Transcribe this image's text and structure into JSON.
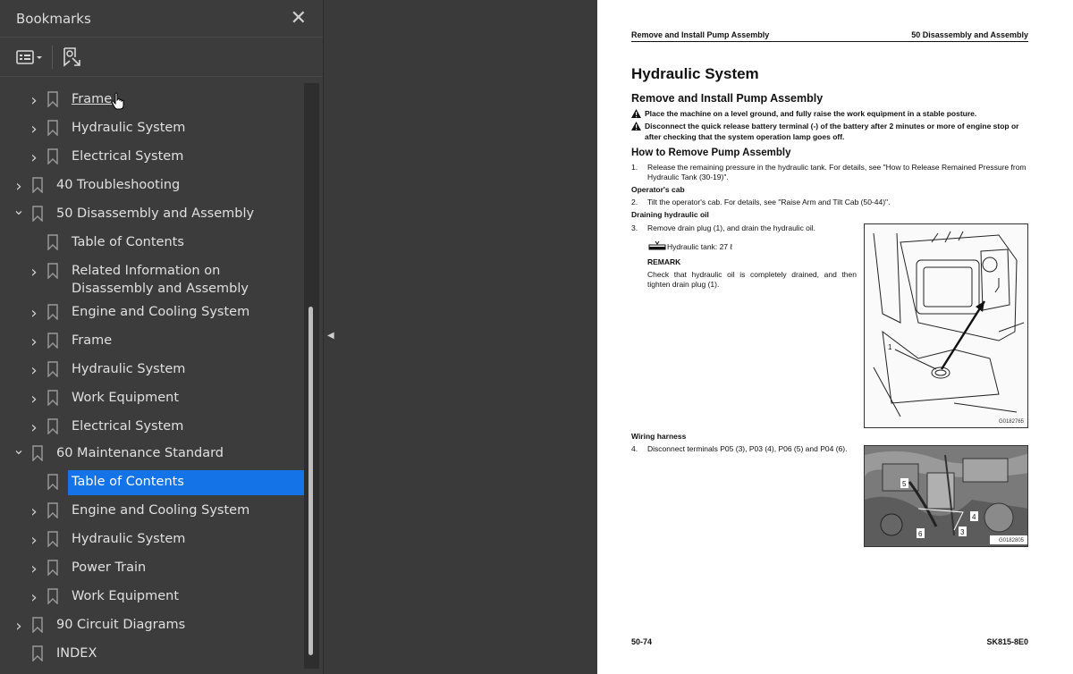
{
  "panel": {
    "title": "Bookmarks",
    "items": [
      {
        "label": "Frame",
        "level": 2,
        "expand": "collapsed",
        "state": "hover"
      },
      {
        "label": "Hydraulic System",
        "level": 2,
        "expand": "collapsed"
      },
      {
        "label": "Electrical System",
        "level": 2,
        "expand": "collapsed"
      },
      {
        "label": "40 Troubleshooting",
        "level": 1,
        "expand": "collapsed"
      },
      {
        "label": "50 Disassembly and Assembly",
        "level": 1,
        "expand": "expanded"
      },
      {
        "label": "Table of Contents",
        "level": 2,
        "expand": "none"
      },
      {
        "label": "Related Information on Disassembly and Assembly",
        "level": 2,
        "expand": "collapsed"
      },
      {
        "label": "Engine and Cooling System",
        "level": 2,
        "expand": "collapsed"
      },
      {
        "label": "Frame",
        "level": 2,
        "expand": "collapsed"
      },
      {
        "label": "Hydraulic System",
        "level": 2,
        "expand": "collapsed"
      },
      {
        "label": "Work Equipment",
        "level": 2,
        "expand": "collapsed"
      },
      {
        "label": "Electrical System",
        "level": 2,
        "expand": "collapsed"
      },
      {
        "label": "60 Maintenance Standard",
        "level": 1,
        "expand": "expanded"
      },
      {
        "label": "Table of Contents",
        "level": 2,
        "expand": "none",
        "state": "selected"
      },
      {
        "label": "Engine and Cooling System",
        "level": 2,
        "expand": "collapsed"
      },
      {
        "label": "Hydraulic System",
        "level": 2,
        "expand": "collapsed"
      },
      {
        "label": "Power Train",
        "level": 2,
        "expand": "collapsed"
      },
      {
        "label": "Work Equipment",
        "level": 2,
        "expand": "collapsed"
      },
      {
        "label": "90 Circuit Diagrams",
        "level": 1,
        "expand": "collapsed"
      },
      {
        "label": "INDEX",
        "level": 1,
        "expand": "none"
      }
    ]
  },
  "colors": {
    "selection": "#1473e6",
    "panel_bg": "#3c3c3c",
    "gutter_bg": "#3a3a3a"
  },
  "doc": {
    "header_left": "Remove and Install Pump Assembly",
    "header_right": "50 Disassembly and Assembly",
    "title": "Hydraulic System",
    "subtitle": "Remove and Install Pump Assembly",
    "warning1": "Place the machine on a level ground, and fully raise the work equipment in a stable posture.",
    "warning2": "Disconnect the quick release battery terminal (-) of the battery after 2 minutes or more of engine stop or after checking that the system operation lamp goes off.",
    "section": "How to Remove Pump Assembly",
    "step1_num": "1.",
    "step1": "Release the remaining pressure in the hydraulic tank. For details, see \"How to Release Remained Pressure from Hydraulic Tank (30-19)\".",
    "sub1": "Operator's cab",
    "step2_num": "2.",
    "step2": "Tilt the operator's cab. For details, see \"Raise Arm and Tilt Cab (50-44)\".",
    "sub2": "Draining hydraulic oil",
    "step3_num": "3.",
    "step3": "Remove drain plug (1), and drain the hydraulic oil.",
    "tank": "Hydraulic tank: 27 ℓ",
    "remark_title": "REMARK",
    "remark": "Check that hydraulic oil is completely drained, and then tighten drain plug (1).",
    "fig1_code": "G0182765",
    "fig1_label": "1",
    "sub3": "Wiring harness",
    "step4_num": "4.",
    "step4": "Disconnect terminals P05 (3), P03 (4), P06 (5) and P04 (6).",
    "fig2_code": "G0182805",
    "fig2_labels": [
      "5",
      "4",
      "6",
      "3"
    ],
    "footer_left": "50-74",
    "footer_right": "SK815-8E0"
  }
}
